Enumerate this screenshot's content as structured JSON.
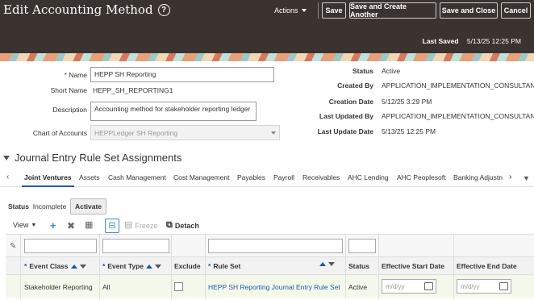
{
  "header": {
    "title": "Edit Accounting Method",
    "actions_label": "Actions",
    "buttons": {
      "save": "Save",
      "save_create_another": "Save and Create Another",
      "save_close": "Save and Close",
      "cancel": "Cancel"
    },
    "last_saved_label": "Last Saved",
    "last_saved_value": "5/13/25 12:25 PM"
  },
  "form": {
    "name_label": "Name",
    "name_value": "HEPP SH Reporting",
    "short_name_label": "Short Name",
    "short_name_value": "HEPP_SH_REPORTING1",
    "description_label": "Description",
    "description_value": "Accounting method for stakeholder reporting ledger",
    "chart_label": "Chart of Accounts",
    "chart_value": "HEPPLedger SH Reporting",
    "status_label": "Status",
    "status_value": "Active",
    "created_by_label": "Created By",
    "created_by_value": "APPLICATION_IMPLEMENTATION_CONSULTANT",
    "creation_date_label": "Creation Date",
    "creation_date_value": "5/12/25 3:29 PM",
    "last_updated_by_label": "Last Updated By",
    "last_updated_by_value": "APPLICATION_IMPLEMENTATION_CONSULTANT",
    "last_update_date_label": "Last Update Date",
    "last_update_date_value": "5/13/25 12:25 PM"
  },
  "section": {
    "title": "Journal Entry Rule Set Assignments"
  },
  "tabs": [
    "Joint Ventures",
    "Assets",
    "Cash Management",
    "Cost Management",
    "Payables",
    "Payroll",
    "Receivables",
    "AHC Lending",
    "AHC Peoplesoft",
    "Banking Adjustn"
  ],
  "status_row": {
    "label": "Status",
    "value": "Incomplete",
    "activate": "Activate"
  },
  "toolbar": {
    "view": "View",
    "freeze": "Freeze",
    "detach": "Detach"
  },
  "table": {
    "headers": {
      "event_class": "Event Class",
      "event_type": "Event Type",
      "exclude": "Exclude",
      "rule_set": "Rule Set",
      "status": "Status",
      "start_date": "Effective Start Date",
      "end_date": "Effective End Date"
    },
    "row": {
      "event_class": "Stakeholder Reporting",
      "event_type": "All",
      "rule_set": "HEPP SH Reporting Journal Entry Rule Set",
      "status": "Active",
      "start_placeholder": "m/d/yy",
      "end_placeholder": "m/d/yy"
    }
  }
}
